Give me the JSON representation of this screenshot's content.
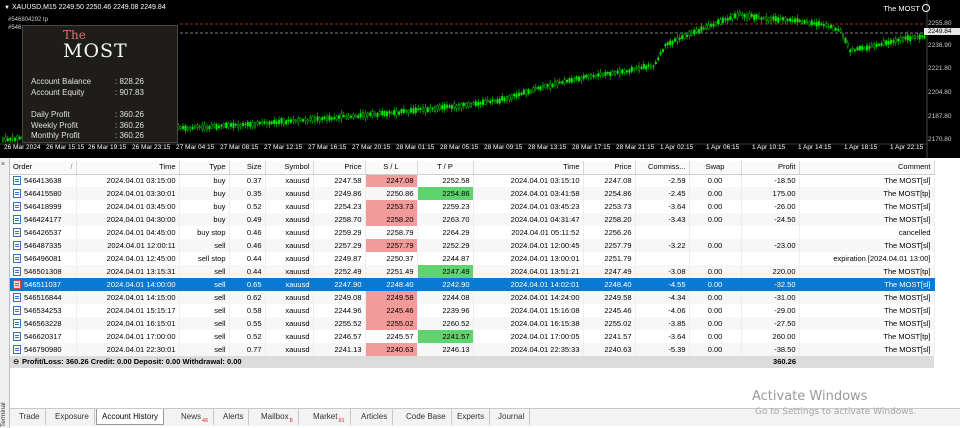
{
  "chart": {
    "symbol_header": "XAUUSD,M15  2249.50 2250.46 2249.08 2249.84",
    "brand_label": "The MOST",
    "ticket_label_1": "#546804292 tp",
    "ticket_label_2": "#546",
    "price_labels": [
      "2255.80",
      "2249.84",
      "2238.90",
      "2221.80",
      "2204.80",
      "2187.80",
      "2170.80"
    ],
    "current_price_label": "2249.84",
    "time_labels": [
      "26 Mar 2024",
      "26 Mar 15:15",
      "26 Mar 19:15",
      "26 Mar 23:15",
      "27 Mar 04:15",
      "27 Mar 08:15",
      "27 Mar 12:15",
      "27 Mar 16:15",
      "27 Mar 20:15",
      "28 Mar 01:15",
      "28 Mar 05:15",
      "28 Mar 09:15",
      "28 Mar 13:15",
      "28 Mar 17:15",
      "28 Mar 21:15",
      "1 Apr 02:15",
      "1 Apr 06:15",
      "1 Apr 10:15",
      "1 Apr 14:15",
      "1 Apr 18:15",
      "1 Apr 22:15"
    ]
  },
  "panel": {
    "the": "The",
    "most": "MOST",
    "rows": [
      {
        "label": "Account Balance",
        "value": ": 828.26"
      },
      {
        "label": "Account Equity",
        "value": ": 907.83"
      },
      {
        "label": "Daily Profit",
        "value": ": 360.26"
      },
      {
        "label": "Weekly Profit",
        "value": ": 360.26"
      },
      {
        "label": "Monthly Profit",
        "value": ": 360.26"
      }
    ]
  },
  "terminal": {
    "close_glyph": "×",
    "side_label": "Terminal",
    "columns": [
      "Order",
      "/",
      "Time",
      "Type",
      "Size",
      "Symbol",
      "Price",
      "S / L",
      "T / P",
      "Time",
      "Price",
      "Commiss...",
      "Swap",
      "Profit",
      "Comment"
    ],
    "rows": [
      {
        "order": "546413638",
        "time": "2024.04.01 03:15:00",
        "type": "buy",
        "size": "0.37",
        "symbol": "xauusd",
        "price": "2247.58",
        "sl": "2247.08",
        "tp": "2252.58",
        "close_time": "2024.04.01 03:15:10",
        "close_price": "2247.08",
        "commission": "-2.59",
        "swap": "0.00",
        "profit": "-18.50",
        "comment": "The MOST[sl]",
        "hit": "sl"
      },
      {
        "order": "546415580",
        "time": "2024.04.01 03:30:01",
        "type": "buy",
        "size": "0.35",
        "symbol": "xauusd",
        "price": "2249.86",
        "sl": "2250.86",
        "tp": "2254.86",
        "close_time": "2024.04.01 03:41:58",
        "close_price": "2254.86",
        "commission": "-2.45",
        "swap": "0.00",
        "profit": "175.00",
        "comment": "The MOST[tp]",
        "hit": "tp"
      },
      {
        "order": "546418999",
        "time": "2024.04.01 03:45:00",
        "type": "buy",
        "size": "0.52",
        "symbol": "xauusd",
        "price": "2254.23",
        "sl": "2253.73",
        "tp": "2259.23",
        "close_time": "2024.04.01 03:45:23",
        "close_price": "2253.73",
        "commission": "-3.64",
        "swap": "0.00",
        "profit": "-26.00",
        "comment": "The MOST[sl]",
        "hit": "sl"
      },
      {
        "order": "546424177",
        "time": "2024.04.01 04:30:00",
        "type": "buy",
        "size": "0.49",
        "symbol": "xauusd",
        "price": "2258.70",
        "sl": "2258.20",
        "tp": "2263.70",
        "close_time": "2024.04.01 04:31:47",
        "close_price": "2258.20",
        "commission": "-3.43",
        "swap": "0.00",
        "profit": "-24.50",
        "comment": "The MOST[sl]",
        "hit": "sl"
      },
      {
        "order": "546426537",
        "time": "2024.04.01 04:45:00",
        "type": "buy stop",
        "size": "0.46",
        "symbol": "xauusd",
        "price": "2259.29",
        "sl": "2258.79",
        "tp": "2264.29",
        "close_time": "2024.04.01 05:11:52",
        "close_price": "2256.26",
        "commission": "",
        "swap": "",
        "profit": "",
        "comment": "cancelled",
        "hit": ""
      },
      {
        "order": "546487335",
        "time": "2024.04.01 12:00:11",
        "type": "sell",
        "size": "0.46",
        "symbol": "xauusd",
        "price": "2257.29",
        "sl": "2257.79",
        "tp": "2252.29",
        "close_time": "2024.04.01 12:00:45",
        "close_price": "2257.79",
        "commission": "-3.22",
        "swap": "0.00",
        "profit": "-23.00",
        "comment": "The MOST[sl]",
        "hit": "sl"
      },
      {
        "order": "546496081",
        "time": "2024.04.01 12:45:00",
        "type": "sell stop",
        "size": "0.44",
        "symbol": "xauusd",
        "price": "2249.87",
        "sl": "2250.37",
        "tp": "2244.87",
        "close_time": "2024.04.01 13:00:01",
        "close_price": "2251.79",
        "commission": "",
        "swap": "",
        "profit": "",
        "comment": "expiration [2024.04.01 13:00]",
        "hit": ""
      },
      {
        "order": "546501308",
        "time": "2024.04.01 13:15:31",
        "type": "sell",
        "size": "0.44",
        "symbol": "xauusd",
        "price": "2252.49",
        "sl": "2251.49",
        "tp": "2247.49",
        "close_time": "2024.04.01 13:51:21",
        "close_price": "2247.49",
        "commission": "-3.08",
        "swap": "0.00",
        "profit": "220.00",
        "comment": "The MOST[tp]",
        "hit": "tp"
      },
      {
        "order": "546511037",
        "time": "2024.04.01 14:00:00",
        "type": "sell",
        "size": "0.65",
        "symbol": "xauusd",
        "price": "2247.90",
        "sl": "2248.40",
        "tp": "2242.90",
        "close_time": "2024.04.01 14:02:01",
        "close_price": "2248.40",
        "commission": "-4.55",
        "swap": "0.00",
        "profit": "-32.50",
        "comment": "The MOST[sl]",
        "hit": "sl",
        "selected": true
      },
      {
        "order": "546516844",
        "time": "2024.04.01 14:15:00",
        "type": "sell",
        "size": "0.62",
        "symbol": "xauusd",
        "price": "2249.08",
        "sl": "2249.58",
        "tp": "2244.08",
        "close_time": "2024.04.01 14:24:00",
        "close_price": "2249.58",
        "commission": "-4.34",
        "swap": "0.00",
        "profit": "-31.00",
        "comment": "The MOST[sl]",
        "hit": "sl"
      },
      {
        "order": "546534253",
        "time": "2024.04.01 15:15:17",
        "type": "sell",
        "size": "0.58",
        "symbol": "xauusd",
        "price": "2244.96",
        "sl": "2245.46",
        "tp": "2239.96",
        "close_time": "2024.04.01 15:16:08",
        "close_price": "2245.46",
        "commission": "-4.06",
        "swap": "0.00",
        "profit": "-29.00",
        "comment": "The MOST[sl]",
        "hit": "sl"
      },
      {
        "order": "546563228",
        "time": "2024.04.01 16:15:01",
        "type": "sell",
        "size": "0.55",
        "symbol": "xauusd",
        "price": "2255.52",
        "sl": "2255.02",
        "tp": "2260.52",
        "close_time": "2024.04.01 16:15:38",
        "close_price": "2255.02",
        "commission": "-3.85",
        "swap": "0.00",
        "profit": "-27.50",
        "comment": "The MOST[sl]",
        "hit": "sl"
      },
      {
        "order": "546620317",
        "time": "2024.04.01 17:00:00",
        "type": "sell",
        "size": "0.52",
        "symbol": "xauusd",
        "price": "2246.57",
        "sl": "2245.57",
        "tp": "2241.57",
        "close_time": "2024.04.01 17:00:05",
        "close_price": "2241.57",
        "commission": "-3.64",
        "swap": "0.00",
        "profit": "260.00",
        "comment": "The MOST[tp]",
        "hit": "tp"
      },
      {
        "order": "546790980",
        "time": "2024.04.01 22:30:01",
        "type": "sell",
        "size": "0.77",
        "symbol": "xauusd",
        "price": "2241.13",
        "sl": "2240.63",
        "tp": "2246.13",
        "close_time": "2024.04.01 22:35:33",
        "close_price": "2240.63",
        "commission": "-5.39",
        "swap": "0.00",
        "profit": "-38.50",
        "comment": "The MOST[sl]",
        "hit": "sl"
      }
    ],
    "summary": {
      "text": "Profit/Loss: 360.26  Credit: 0.00  Deposit: 0.00  Withdrawal: 0.00",
      "total": "360.26"
    },
    "tabs": [
      {
        "label": "Trade",
        "badge": ""
      },
      {
        "label": "Exposure",
        "badge": ""
      },
      {
        "label": "Account History",
        "badge": "",
        "active": true
      },
      {
        "label": "News",
        "badge": "46"
      },
      {
        "label": "Alerts",
        "badge": ""
      },
      {
        "label": "Mailbox",
        "badge": "8"
      },
      {
        "label": "Market",
        "badge": "91"
      },
      {
        "label": "Articles",
        "badge": ""
      },
      {
        "label": "Code Base",
        "badge": ""
      },
      {
        "label": "Experts",
        "badge": ""
      },
      {
        "label": "Journal",
        "badge": ""
      }
    ]
  },
  "watermark": {
    "title": "Activate Windows",
    "subtitle": "Go to Settings to activate Windows."
  },
  "colors": {
    "bull_candle": "#00e600",
    "chart_bg": "#000000",
    "selected_row": "#0a79d3",
    "sl_hit": "#f39a9a",
    "tp_hit": "#5fd36d"
  }
}
